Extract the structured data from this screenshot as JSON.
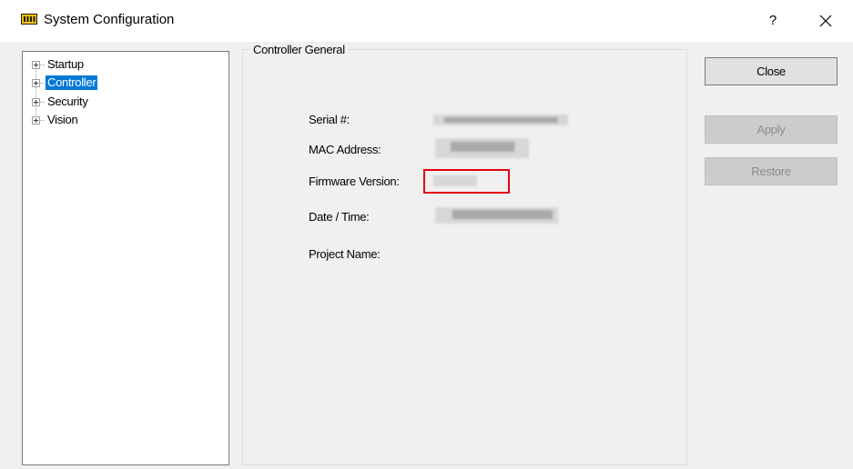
{
  "window": {
    "title": "System Configuration",
    "help_label": "?",
    "icon": "display-adapter-icon",
    "close_icon": "close-icon"
  },
  "tree": {
    "items": [
      {
        "label": "Startup",
        "selected": false
      },
      {
        "label": "Controller",
        "selected": true
      },
      {
        "label": "Security",
        "selected": false
      },
      {
        "label": "Vision",
        "selected": false
      }
    ]
  },
  "panel": {
    "title": "Controller General",
    "fields": [
      {
        "label": "Serial #:"
      },
      {
        "label": "MAC Address:"
      },
      {
        "label": "Firmware Version:"
      },
      {
        "label": "Date / Time:"
      },
      {
        "label": "Project Name:"
      }
    ]
  },
  "buttons": {
    "close": "Close",
    "apply": "Apply",
    "restore": "Restore"
  },
  "colors": {
    "selection": "#0078d7",
    "highlight": "#e4000f"
  }
}
